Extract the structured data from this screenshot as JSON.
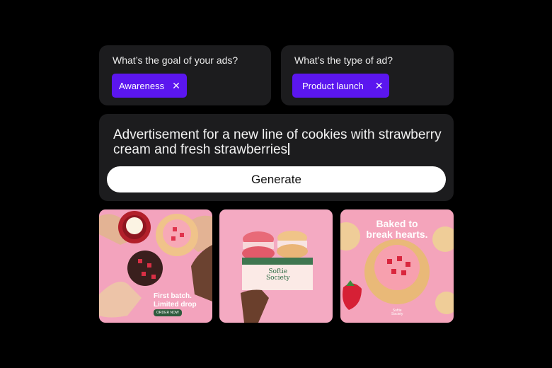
{
  "goal": {
    "question": "What’s the goal of your ads?",
    "chip_label": "Awareness"
  },
  "ad_type": {
    "question": "What’s the type of ad?",
    "chip_label": "Product launch"
  },
  "prompt": {
    "text": "Advertisement for a new line of cookies with strawberry cream and fresh strawberries",
    "generate_label": "Generate"
  },
  "results": [
    {
      "headline_line1": "First batch.",
      "headline_line2": "Limited drop",
      "cta": "ORDER NOW"
    },
    {
      "box_brand_line1": "Softie",
      "box_brand_line2": "Society"
    },
    {
      "headline_line1": "Baked to",
      "headline_line2": "break hearts.",
      "brand_line1": "Softie",
      "brand_line2": "Society"
    }
  ],
  "colors": {
    "accent": "#5b16ef",
    "card": "#1c1c1e",
    "tile_pink": "#f2a8bf"
  }
}
